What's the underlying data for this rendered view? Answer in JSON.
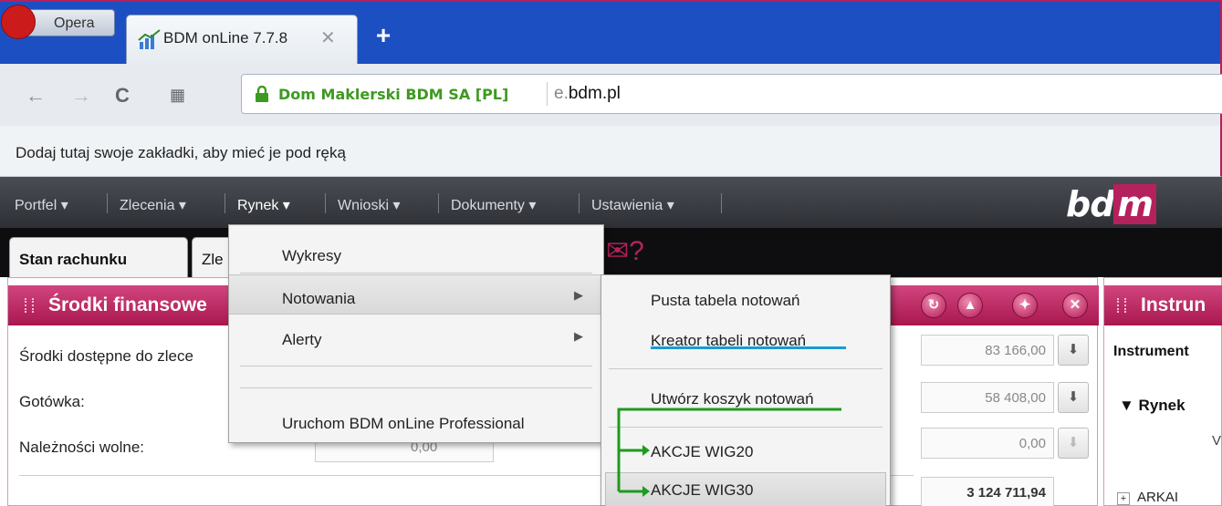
{
  "browser": {
    "opera_label": "Opera",
    "tab_title": "BDM onLine 7.7.8",
    "site_name": "Dom Maklerski BDM SA [PL]",
    "url_prefix": "e.",
    "url_domain": "bdm.pl",
    "bookmarks_hint": "Dodaj tutaj swoje zakładki, aby mieć je pod ręką"
  },
  "menu": {
    "items": [
      "Portfel ▾",
      "Zlecenia ▾",
      "Rynek ▾",
      "Wnioski ▾",
      "Dokumenty ▾",
      "Ustawienia ▾"
    ],
    "logo_bd": "bd",
    "logo_m": "m"
  },
  "tabs": [
    "Stan rachunku",
    "Zle"
  ],
  "tab_icons": "✉?",
  "panel_left": {
    "title": "Środki finansowe",
    "rows": [
      {
        "label": "Środki dostępne do zlece",
        "value": "83 166,00"
      },
      {
        "label": "Gotówka:",
        "value": "58 408,00"
      },
      {
        "label": "Należności wolne:",
        "value": "0,00"
      }
    ],
    "hidden_value": "0,00",
    "bottom_value": "3 124 711,94"
  },
  "panel_right": {
    "title": "Instrun",
    "instrument_label": "Instrument",
    "rynek_label": "▼ Rynek",
    "col_v": "V",
    "arkai": "ARKAI"
  },
  "dropdown": {
    "items": [
      "Wykresy",
      "Notowania",
      "Alerty",
      "Uruchom BDM onLine Professional"
    ]
  },
  "submenu": {
    "items": [
      "Pusta tabela notowań",
      "Kreator tabeli notowań",
      "Utwórz koszyk notowań",
      "AKCJE WIG20",
      "AKCJE WIG30"
    ]
  },
  "colors": {
    "accent": "#b5215c",
    "annotation_green": "#1e9a1e",
    "underline_blue": "#1a9ad6"
  }
}
